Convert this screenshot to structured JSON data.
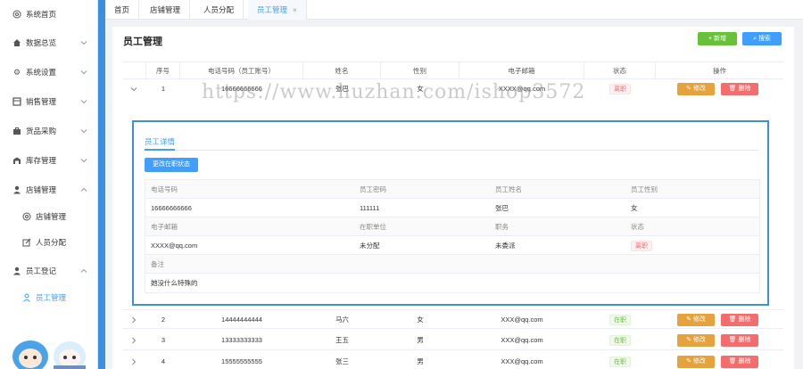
{
  "sidebar": {
    "items": [
      {
        "label": "系统首页",
        "icon": "settings-circle-icon"
      },
      {
        "label": "数据总览",
        "icon": "home-icon"
      },
      {
        "label": "系统设置",
        "icon": "gear-icon"
      },
      {
        "label": "销售管理",
        "icon": "grid-icon"
      },
      {
        "label": "货品采购",
        "icon": "briefcase-icon"
      },
      {
        "label": "库存管理",
        "icon": "warehouse-icon"
      },
      {
        "label": "店铺管理",
        "icon": "user-icon"
      },
      {
        "label": "店铺管理",
        "icon": "settings-circle-icon"
      },
      {
        "label": "人员分配",
        "icon": "edit-icon"
      },
      {
        "label": "员工登记",
        "icon": "user-icon"
      },
      {
        "label": "员工管理",
        "icon": "person-outline-icon"
      }
    ]
  },
  "tabs": [
    {
      "label": "首页"
    },
    {
      "label": "店铺管理"
    },
    {
      "label": "人员分配"
    },
    {
      "label": "员工管理",
      "close": "×"
    }
  ],
  "page": {
    "title": "员工管理",
    "add_label": "+ 新增",
    "search_label": "搜索"
  },
  "table": {
    "headers": [
      "序号",
      "电话号码（员工账号）",
      "姓名",
      "性别",
      "电子邮箱",
      "状态",
      "操作"
    ],
    "edit_label": "修改",
    "delete_label": "删除",
    "expanded_row": {
      "no": "1",
      "phone": "16666666666",
      "name": "张巴",
      "gender": "女",
      "email": "XXXX@qq.com",
      "status": "离职"
    },
    "rows": [
      {
        "no": "2",
        "phone": "14444444444",
        "name": "马六",
        "gender": "女",
        "email": "XXX@qq.com",
        "status": "在职"
      },
      {
        "no": "3",
        "phone": "13333333333",
        "name": "王五",
        "gender": "男",
        "email": "XXX@qq.com",
        "status": "在职"
      },
      {
        "no": "4",
        "phone": "15555555555",
        "name": "张三",
        "gender": "男",
        "email": "XXX@qq.com",
        "status": "在职"
      }
    ]
  },
  "detail": {
    "tab_label": "员工详情",
    "change_status_label": "更改在职状态",
    "row1_labels": [
      "电话号码",
      "员工密码",
      "员工姓名",
      "员工性别"
    ],
    "row1_values": [
      "16666666666",
      "111111",
      "张巴",
      "女"
    ],
    "row2_labels": [
      "电子邮箱",
      "在职单位",
      "职务",
      "状态"
    ],
    "row2_values": [
      "XXXX@qq.com",
      "未分配",
      "未委派",
      "离职"
    ],
    "note_label": "备注",
    "note_value": "她没什么特殊的"
  },
  "watermark": "https://www.huzhan.com/ishop3572"
}
